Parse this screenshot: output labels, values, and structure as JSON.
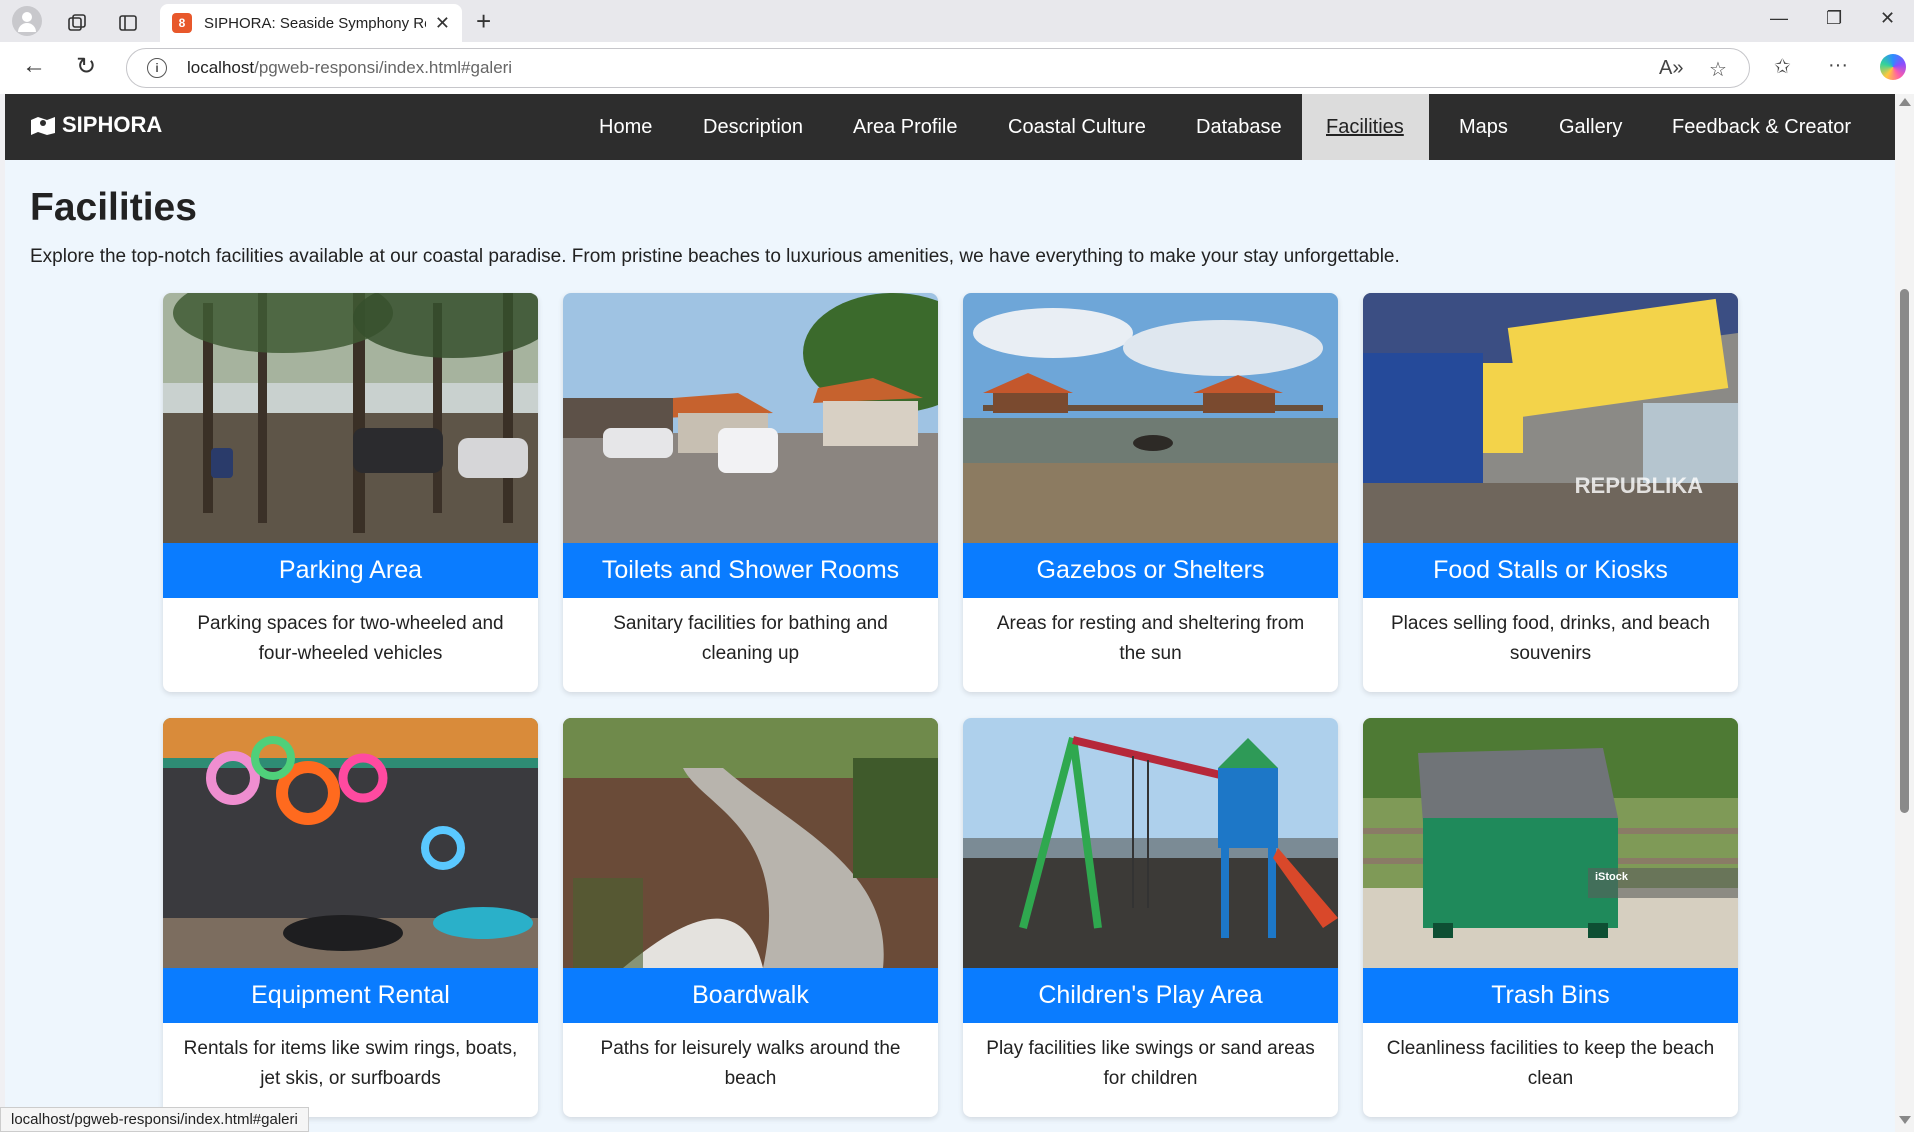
{
  "browser": {
    "tab_title": "SIPHORA: Seaside Symphony Ren",
    "favicon_letter": "8",
    "url_host": "localhost",
    "url_path": "/pgweb-responsi/index.html#galeri",
    "status_url": "localhost/pgweb-responsi/index.html#galeri"
  },
  "site": {
    "brand": "SIPHORA",
    "nav": [
      {
        "label": "Home"
      },
      {
        "label": "Description"
      },
      {
        "label": "Area Profile"
      },
      {
        "label": "Coastal Culture"
      },
      {
        "label": "Database"
      },
      {
        "label": "Facilities",
        "active": true
      },
      {
        "label": "Maps"
      },
      {
        "label": "Gallery"
      },
      {
        "label": "Feedback & Creator"
      }
    ]
  },
  "section": {
    "title": "Facilities",
    "description": "Explore the top-notch facilities available at our coastal paradise. From pristine beaches to luxurious amenities, we have everything to make your stay unforgettable."
  },
  "cards": [
    {
      "title": "Parking Area",
      "text": "Parking spaces for two-wheeled and four-wheeled vehicles",
      "photo": "parking-photo"
    },
    {
      "title": "Toilets and Shower Rooms",
      "text": "Sanitary facilities for bathing and cleaning up",
      "photo": "toilets-photo"
    },
    {
      "title": "Gazebos or Shelters",
      "text": "Areas for resting and sheltering from the sun",
      "photo": "gazebo-photo"
    },
    {
      "title": "Food Stalls or Kiosks",
      "text": "Places selling food, drinks, and beach souvenirs",
      "photo": "food-stall-photo",
      "watermark": "REPUBLIKA"
    },
    {
      "title": "Equipment Rental",
      "text": "Rentals for items like swim rings, boats, jet skis, or surfboards",
      "photo": "rental-photo"
    },
    {
      "title": "Boardwalk",
      "text": "Paths for leisurely walks around the beach",
      "photo": "boardwalk-photo"
    },
    {
      "title": "Children's Play Area",
      "text": "Play facilities like swings or sand areas for children",
      "photo": "playground-photo"
    },
    {
      "title": "Trash Bins",
      "text": "Cleanliness facilities to keep the beach clean",
      "photo": "trash-bin-photo",
      "watermark": "iStock"
    }
  ],
  "colors": {
    "nav_bg": "#2d2d2d",
    "accent": "#0a7cff",
    "page_bg": "#eef6fd"
  }
}
